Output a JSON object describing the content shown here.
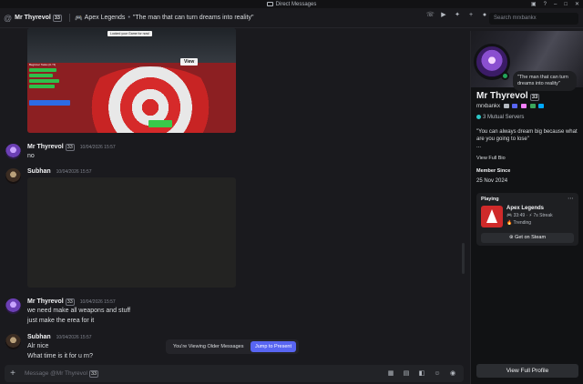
{
  "window": {
    "title": "Direct Messages"
  },
  "header": {
    "username": "Mr Thyrevol",
    "badge": "33",
    "activity": "Apex Legends",
    "separator": "•",
    "status": "\"The man that can turn dreams into reality\""
  },
  "search": {
    "placeholder": "Search mrxbankx"
  },
  "messages": [
    {
      "author": "Mr Thyrevol",
      "badge": "33",
      "time": "10/04/2026 15:57",
      "lines": [
        "no"
      ]
    },
    {
      "author": "Subhan",
      "time": "10/04/2026 15:57",
      "lines": []
    },
    {
      "author": "Mr Thyrevol",
      "badge": "33",
      "time": "10/04/2026 15:57",
      "lines": [
        "we need make all weapons and stuff",
        "just make the erea for it"
      ]
    },
    {
      "author": "Subhan",
      "time": "10/04/2026 15:57",
      "lines": [
        "Alr nice",
        "What time is it for u rn?"
      ]
    }
  ],
  "attachment_game": {
    "label_top": "Locked your Game for now!",
    "label_view": "View",
    "hud_title": "Beginner Tasks (0 / 5)"
  },
  "older_bar": {
    "text": "You're Viewing Older Messages",
    "jump_label": "Jump to Present"
  },
  "composer": {
    "placeholder": "Message @Mr Thyrevol",
    "badge": "33"
  },
  "profile": {
    "bubble": "\"The man that can turn dreams into reality\"",
    "name": "Mr Thyrevol",
    "badge": "33",
    "username": "mrxbankx",
    "mutual": "3 Mutual Servers",
    "bio": "\"You can always dream big because what are you going to lose\"",
    "bio_extra": "...",
    "view_full_bio": "View Full Bio",
    "member_since_label": "Member Since",
    "member_since": "25 Nov 2024",
    "playing_label": "Playing",
    "game_name": "Apex Legends",
    "game_time": "33:49",
    "game_streak": "7s Streak",
    "game_trend": "Trending",
    "steam_button": "Get on Steam",
    "view_full_profile": "View Full Profile"
  },
  "colors": {
    "accent": "#5865f2",
    "online": "#23a55a",
    "apex": "#cf2a2a"
  }
}
